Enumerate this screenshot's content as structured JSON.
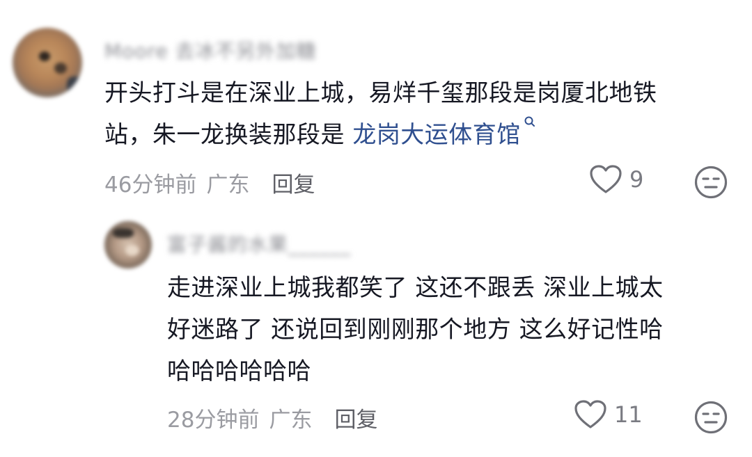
{
  "comments": [
    {
      "username": "Moore 去冰不另外加糖",
      "content_lines": [
        "开头打斗是在深业上城，易烊千玺那段是岗厦北地铁",
        "站，朱一龙换装那段是 "
      ],
      "link_text": "龙岗大运体育馆",
      "time": "46分钟前",
      "location": "广东",
      "reply_label": "回复",
      "likes": "9"
    },
    {
      "username": "富子酱的水果______",
      "content_lines": [
        "走进深业上城我都笑了 这还不跟丢 深业上城太",
        "好迷路了 还说回到刚刚那个地方 这么好记性哈",
        "哈哈哈哈哈哈"
      ],
      "time": "28分钟前",
      "location": "广东",
      "reply_label": "回复",
      "likes": "11"
    }
  ],
  "icons": {
    "like": "heart-outline-icon",
    "dislike": "meh-face-icon",
    "search": "search-mini-icon"
  },
  "colors": {
    "text": "#161823",
    "meta": "#9a9ba1",
    "link": "#2f4f8f",
    "icon": "#7a7b82"
  }
}
